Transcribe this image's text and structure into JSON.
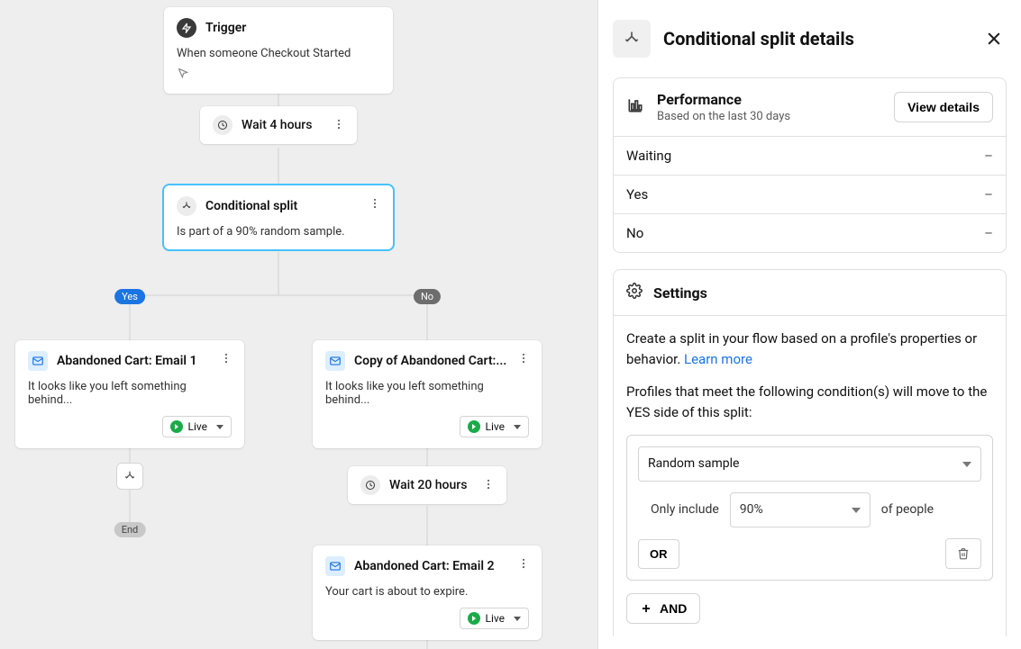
{
  "canvas": {
    "trigger": {
      "title": "Trigger",
      "desc": "When someone Checkout Started"
    },
    "wait1": {
      "label": "Wait 4 hours"
    },
    "split": {
      "title": "Conditional split",
      "desc": "Is part of a 90% random sample."
    },
    "badges": {
      "yes": "Yes",
      "no": "No",
      "end": "End"
    },
    "yes_email": {
      "title": "Abandoned Cart: Email 1",
      "desc": "It looks like you left something behind...",
      "status": "Live"
    },
    "no_email1": {
      "title": "Copy of Abandoned Cart:...",
      "desc": "It looks like you left something behind...",
      "status": "Live"
    },
    "wait2": {
      "label": "Wait 20 hours"
    },
    "no_email2": {
      "title": "Abandoned Cart: Email 2",
      "desc": "Your cart is about to expire.",
      "status": "Live"
    }
  },
  "drawer": {
    "title": "Conditional split details",
    "performance": {
      "title": "Performance",
      "subtitle": "Based on the last 30 days",
      "button": "View details",
      "rows": {
        "waiting": {
          "label": "Waiting",
          "value": "–"
        },
        "yes": {
          "label": "Yes",
          "value": "–"
        },
        "no": {
          "label": "No",
          "value": "–"
        }
      }
    },
    "settings": {
      "title": "Settings",
      "desc_prefix": "Create a split in your flow based on a profile's properties or behavior. ",
      "learn_more": "Learn more",
      "yes_desc": "Profiles that meet the following condition(s) will move to the YES side of this split:",
      "condition_type": "Random sample",
      "only_include": "Only include",
      "percent": "90%",
      "of_people": "of people",
      "or": "OR",
      "and": "AND"
    }
  }
}
